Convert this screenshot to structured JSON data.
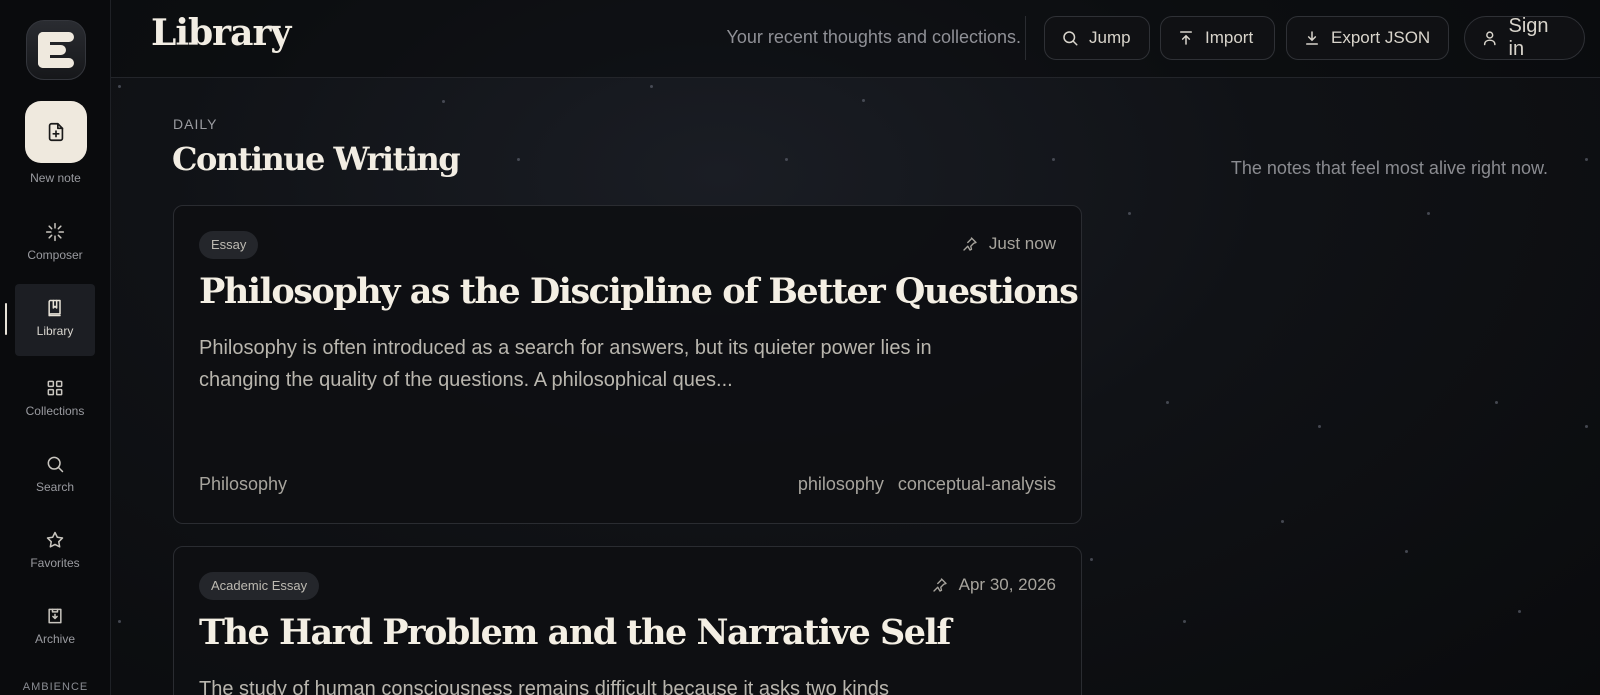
{
  "sidebar": {
    "logo_letter": "E",
    "new_note_label": "New note",
    "items": [
      {
        "label": "Composer",
        "icon": "sparkle-icon"
      },
      {
        "label": "Library",
        "icon": "book-icon"
      },
      {
        "label": "Collections",
        "icon": "grid-icon"
      },
      {
        "label": "Search",
        "icon": "search-icon"
      },
      {
        "label": "Favorites",
        "icon": "star-icon"
      },
      {
        "label": "Archive",
        "icon": "archive-icon"
      }
    ],
    "ambience_label": "AMBIENCE"
  },
  "header": {
    "title": "Library",
    "subtitle": "Your recent thoughts and collections.",
    "jump_label": "Jump",
    "import_label": "Import",
    "export_label": "Export JSON",
    "signin_label": "Sign in"
  },
  "main": {
    "kicker": "DAILY",
    "section_title": "Continue Writing",
    "right_note": "The notes that feel most alive right now.",
    "cards": [
      {
        "badge": "Essay",
        "time": "Just now",
        "title": "Philosophy as the Discipline of Better Questions",
        "excerpt": "Philosophy is often introduced as a search for answers, but its quieter power lies in changing the quality of the questions. A philosophical ques...",
        "category": "Philosophy",
        "tags": [
          "philosophy",
          "conceptual-analysis"
        ]
      },
      {
        "badge": "Academic Essay",
        "time": "Apr 30, 2026",
        "title": "The Hard Problem and the Narrative Self",
        "excerpt": "The study of human consciousness remains difficult because it asks two kinds"
      }
    ]
  },
  "colors": {
    "accent": "#efe9de",
    "background": "#0b0c0e",
    "text": "#f2ede3"
  }
}
